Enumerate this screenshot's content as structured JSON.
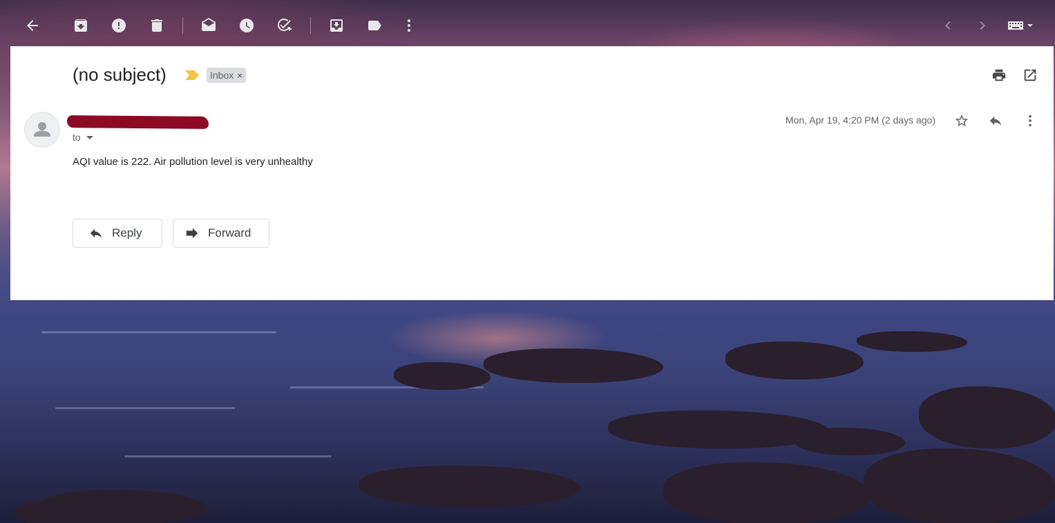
{
  "toolbar": {
    "buttons": [
      {
        "name": "back",
        "icon": "arrow-left-icon"
      },
      {
        "name": "archive",
        "icon": "archive-icon"
      },
      {
        "name": "report-spam",
        "icon": "report-spam-icon"
      },
      {
        "name": "delete",
        "icon": "trash-icon"
      },
      {
        "name": "mark-unread",
        "icon": "mail-open-icon"
      },
      {
        "name": "snooze",
        "icon": "clock-icon"
      },
      {
        "name": "add-to-tasks",
        "icon": "add-task-icon"
      },
      {
        "name": "move-to",
        "icon": "move-to-inbox-icon"
      },
      {
        "name": "labels",
        "icon": "label-icon"
      },
      {
        "name": "more",
        "icon": "more-vertical-icon"
      },
      {
        "name": "newer",
        "icon": "chevron-left-icon"
      },
      {
        "name": "older",
        "icon": "chevron-right-icon"
      },
      {
        "name": "input-tools",
        "icon": "keyboard-icon"
      }
    ]
  },
  "email": {
    "subject": "(no subject)",
    "label": "Inbox",
    "label_remove": "×",
    "to_label": "to",
    "date": "Mon, Apr 19, 4:20 PM (2 days ago)",
    "body": "AQI value is 222. Air pollution level is very unhealthy"
  },
  "actions": {
    "reply_label": "Reply",
    "forward_label": "Forward"
  },
  "colors": {
    "importance_marker": "#f4c542",
    "redaction": "#8c0a24",
    "panel_background": "#ffffff"
  }
}
